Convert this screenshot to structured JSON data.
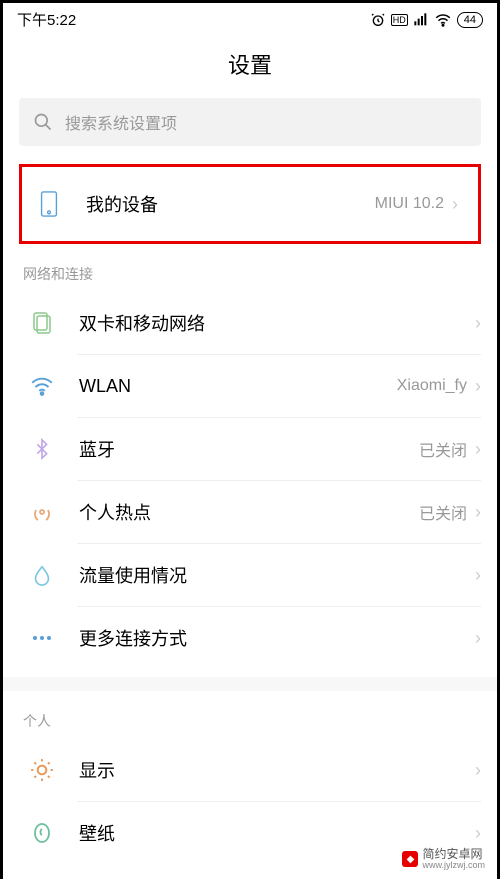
{
  "status": {
    "time": "下午5:22",
    "battery": "44"
  },
  "page": {
    "title": "设置"
  },
  "search": {
    "placeholder": "搜索系统设置项"
  },
  "my_device": {
    "label": "我的设备",
    "value": "MIUI 10.2"
  },
  "sections": {
    "network": {
      "header": "网络和连接",
      "items": [
        {
          "label": "双卡和移动网络",
          "value": ""
        },
        {
          "label": "WLAN",
          "value": "Xiaomi_fy"
        },
        {
          "label": "蓝牙",
          "value": "已关闭"
        },
        {
          "label": "个人热点",
          "value": "已关闭"
        },
        {
          "label": "流量使用情况",
          "value": ""
        },
        {
          "label": "更多连接方式",
          "value": ""
        }
      ]
    },
    "personal": {
      "header": "个人",
      "items": [
        {
          "label": "显示",
          "value": ""
        },
        {
          "label": "壁纸",
          "value": ""
        }
      ]
    }
  },
  "watermark": {
    "name": "简约安卓网",
    "url": "www.jylzwj.com"
  }
}
